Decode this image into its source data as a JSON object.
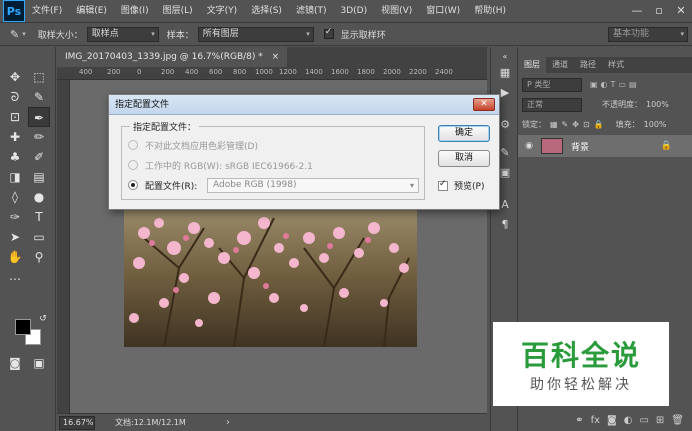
{
  "menubar": {
    "logo": "Ps",
    "items": [
      "文件(F)",
      "编辑(E)",
      "图像(I)",
      "图层(L)",
      "文字(Y)",
      "选择(S)",
      "滤镜(T)",
      "3D(D)",
      "视图(V)",
      "窗口(W)",
      "帮助(H)"
    ],
    "minimize": "—",
    "restore": "▫",
    "close": "✕"
  },
  "options": {
    "eyedropper_icon": "eyedropper-icon",
    "sample_size_label": "取样大小：",
    "sample_size_value": "取样点",
    "sample_label": "样本：",
    "sample_value": "所有图层",
    "show_ring_label": "显示取样环",
    "show_ring_checked": true,
    "workspace": "基本功能"
  },
  "document": {
    "tab_title": "IMG_20170403_1339.jpg @ 16.7%(RGB/8) *",
    "tab_close": "×",
    "ruler_ticks": [
      "400",
      "200",
      "0",
      "200",
      "400",
      "600",
      "800",
      "1000",
      "1200",
      "1400",
      "1600",
      "1800",
      "2000",
      "2200",
      "2400"
    ],
    "zoom": "16.67%",
    "doc_info": "文档:12.1M/12.1M",
    "nav_arrow": "›"
  },
  "panel": {
    "tabs": [
      "图层",
      "通道",
      "路径",
      "样式"
    ],
    "kind_label": "P 类型",
    "blend_mode": "正常",
    "opacity_label": "不透明度：",
    "opacity_value": "100%",
    "lock_label": "锁定：",
    "fill_label": "填充：",
    "fill_value": "100%",
    "layer_name": "背景"
  },
  "dialog": {
    "title": "指定配置文件",
    "close": "✕",
    "legend": "指定配置文件：",
    "opt_no_manage": "不对此文档应用色彩管理(D)",
    "opt_working": "工作中的 RGB(W): sRGB IEC61966-2.1",
    "opt_profile": "配置文件(R):",
    "profile_value": "Adobe RGB (1998)",
    "ok": "确定",
    "cancel": "取消",
    "preview": "预览(P)",
    "preview_checked": true
  },
  "watermark": {
    "title": "百科全说",
    "subtitle": "助你轻松解决"
  }
}
